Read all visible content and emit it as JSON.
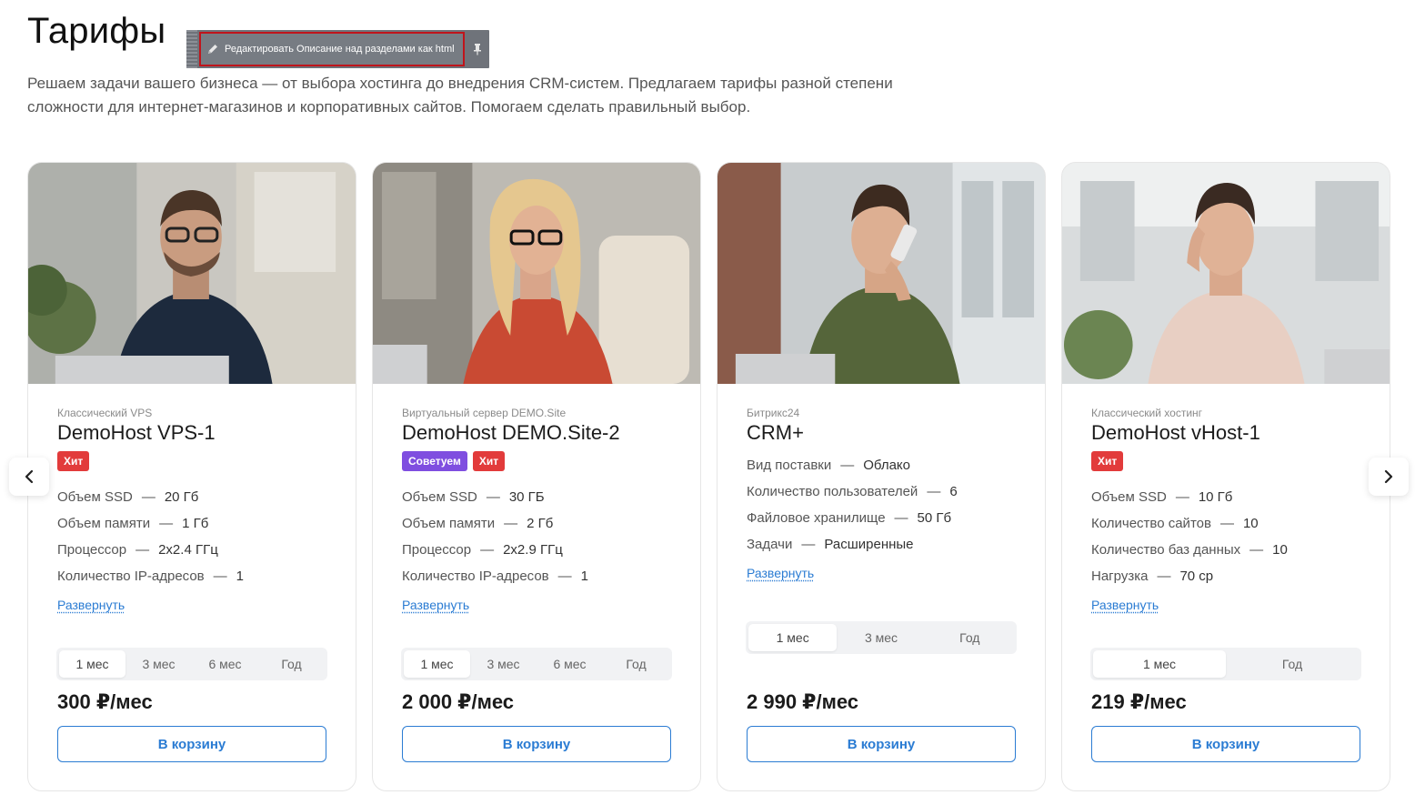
{
  "page": {
    "title": "Тарифы",
    "description": "Решаем задачи вашего бизнеса — от выбора хостинга до внедрения CRM-систем. Предлагаем тарифы разной степени сложности для интернет-магазинов и корпоративных сайтов. Помогаем сделать правильный выбор."
  },
  "admin": {
    "edit_label": "Редактировать Описание над разделами как html",
    "pin_icon": "pin-icon"
  },
  "cards": [
    {
      "category": "Классический VPS",
      "name": "DemoHost VPS-1",
      "badges": [
        {
          "label": "Хит",
          "kind": "hit"
        }
      ],
      "props": [
        {
          "label": "Объем SSD",
          "value": "20 Гб"
        },
        {
          "label": "Объем памяти",
          "value": "1 Гб"
        },
        {
          "label": "Процессор",
          "value": "2x2.4 ГГц"
        },
        {
          "label": "Количество IP-адресов",
          "value": "1"
        }
      ],
      "expand": "Развернуть",
      "periods": [
        "1 мес",
        "3 мес",
        "6 мес",
        "Год"
      ],
      "active_period": "1 мес",
      "price": "300 ₽/мес",
      "cart": "В корзину"
    },
    {
      "category": "Виртуальный сервер DEMO.Site",
      "name": "DemoHost DEMO.Site-2",
      "badges": [
        {
          "label": "Советуем",
          "kind": "advice"
        },
        {
          "label": "Хит",
          "kind": "hit"
        }
      ],
      "props": [
        {
          "label": "Объем SSD",
          "value": "30 ГБ"
        },
        {
          "label": "Объем памяти",
          "value": "2 Гб"
        },
        {
          "label": "Процессор",
          "value": "2x2.9 ГГц"
        },
        {
          "label": "Количество IP-адресов",
          "value": "1"
        }
      ],
      "expand": "Развернуть",
      "periods": [
        "1 мес",
        "3 мес",
        "6 мес",
        "Год"
      ],
      "active_period": "1 мес",
      "price": "2 000 ₽/мес",
      "cart": "В корзину"
    },
    {
      "category": "Битрикс24",
      "name": "CRM+",
      "badges": [],
      "props": [
        {
          "label": "Вид поставки",
          "value": "Облако"
        },
        {
          "label": "Количество пользователей",
          "value": "6"
        },
        {
          "label": "Файловое хранилище",
          "value": "50 Гб"
        },
        {
          "label": "Задачи",
          "value": "Расширенные"
        }
      ],
      "expand": "Развернуть",
      "periods": [
        "1 мес",
        "3 мес",
        "Год"
      ],
      "active_period": "1 мес",
      "price": "2 990 ₽/мес",
      "cart": "В корзину"
    },
    {
      "category": "Классический хостинг",
      "name": "DemoHost vHost-1",
      "badges": [
        {
          "label": "Хит",
          "kind": "hit"
        }
      ],
      "props": [
        {
          "label": "Объем SSD",
          "value": "10 Гб"
        },
        {
          "label": "Количество сайтов",
          "value": "10"
        },
        {
          "label": "Количество баз данных",
          "value": "10"
        },
        {
          "label": "Нагрузка",
          "value": "70 ср"
        }
      ],
      "expand": "Развернуть",
      "periods": [
        "1 мес",
        "Год"
      ],
      "active_period": "1 мес",
      "price": "219 ₽/мес",
      "cart": "В корзину"
    }
  ],
  "carousel": {
    "prev_icon": "chevron-left-icon",
    "next_icon": "chevron-right-icon"
  },
  "colors": {
    "accent": "#2b7cd3",
    "badge_hit": "#e23b3b",
    "badge_advice": "#7f4ee0",
    "admin_outline": "#c0141b"
  }
}
